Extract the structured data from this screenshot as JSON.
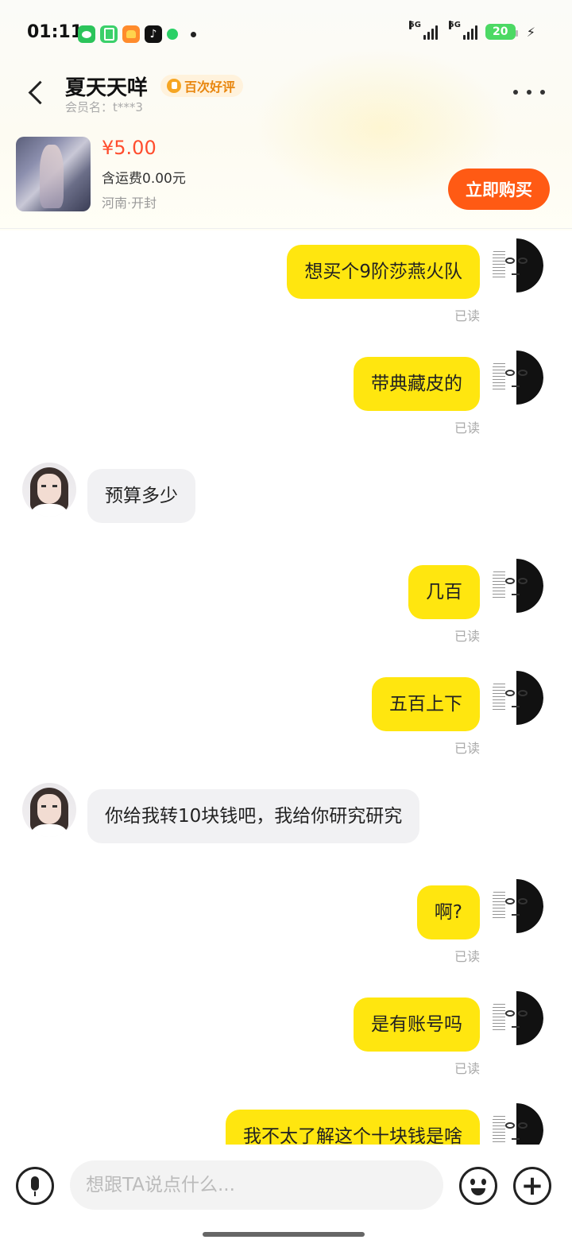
{
  "status_bar": {
    "time": "01:11",
    "network_1": "5G",
    "network_2": "5G",
    "battery": "20",
    "app_icons": [
      "wechat-icon",
      "green-app-icon",
      "game-icon",
      "tiktok-icon",
      "green-dot-icon"
    ]
  },
  "header": {
    "peer_name": "夏天天咩",
    "praise_badge": "百次好评",
    "member_line": "会员名：t***3"
  },
  "product": {
    "price": "¥5.00",
    "shipping": "含运费0.00元",
    "location": "河南·开封",
    "buy_label": "立即购买"
  },
  "messages": [
    {
      "sender": "me",
      "text": "想买个9阶莎燕火队",
      "status": "已读"
    },
    {
      "sender": "me",
      "text": "带典藏皮的",
      "status": "已读"
    },
    {
      "sender": "peer",
      "text": "预算多少"
    },
    {
      "sender": "me",
      "text": "几百",
      "status": "已读"
    },
    {
      "sender": "me",
      "text": "五百上下",
      "status": "已读"
    },
    {
      "sender": "peer",
      "text": "你给我转10块钱吧，我给你研究研究"
    },
    {
      "sender": "me",
      "text": "啊?",
      "status": "已读"
    },
    {
      "sender": "me",
      "text": "是有账号吗",
      "status": "已读"
    },
    {
      "sender": "me",
      "text": "我不太了解这个十块钱是啥"
    }
  ],
  "input": {
    "placeholder": "想跟TA说点什么..."
  },
  "colors": {
    "my_bubble": "#ffe60f",
    "peer_bubble": "#f1f1f3",
    "buy_button": "#ff5a14",
    "price": "#ff4d2e",
    "badge_text": "#e8860e"
  }
}
